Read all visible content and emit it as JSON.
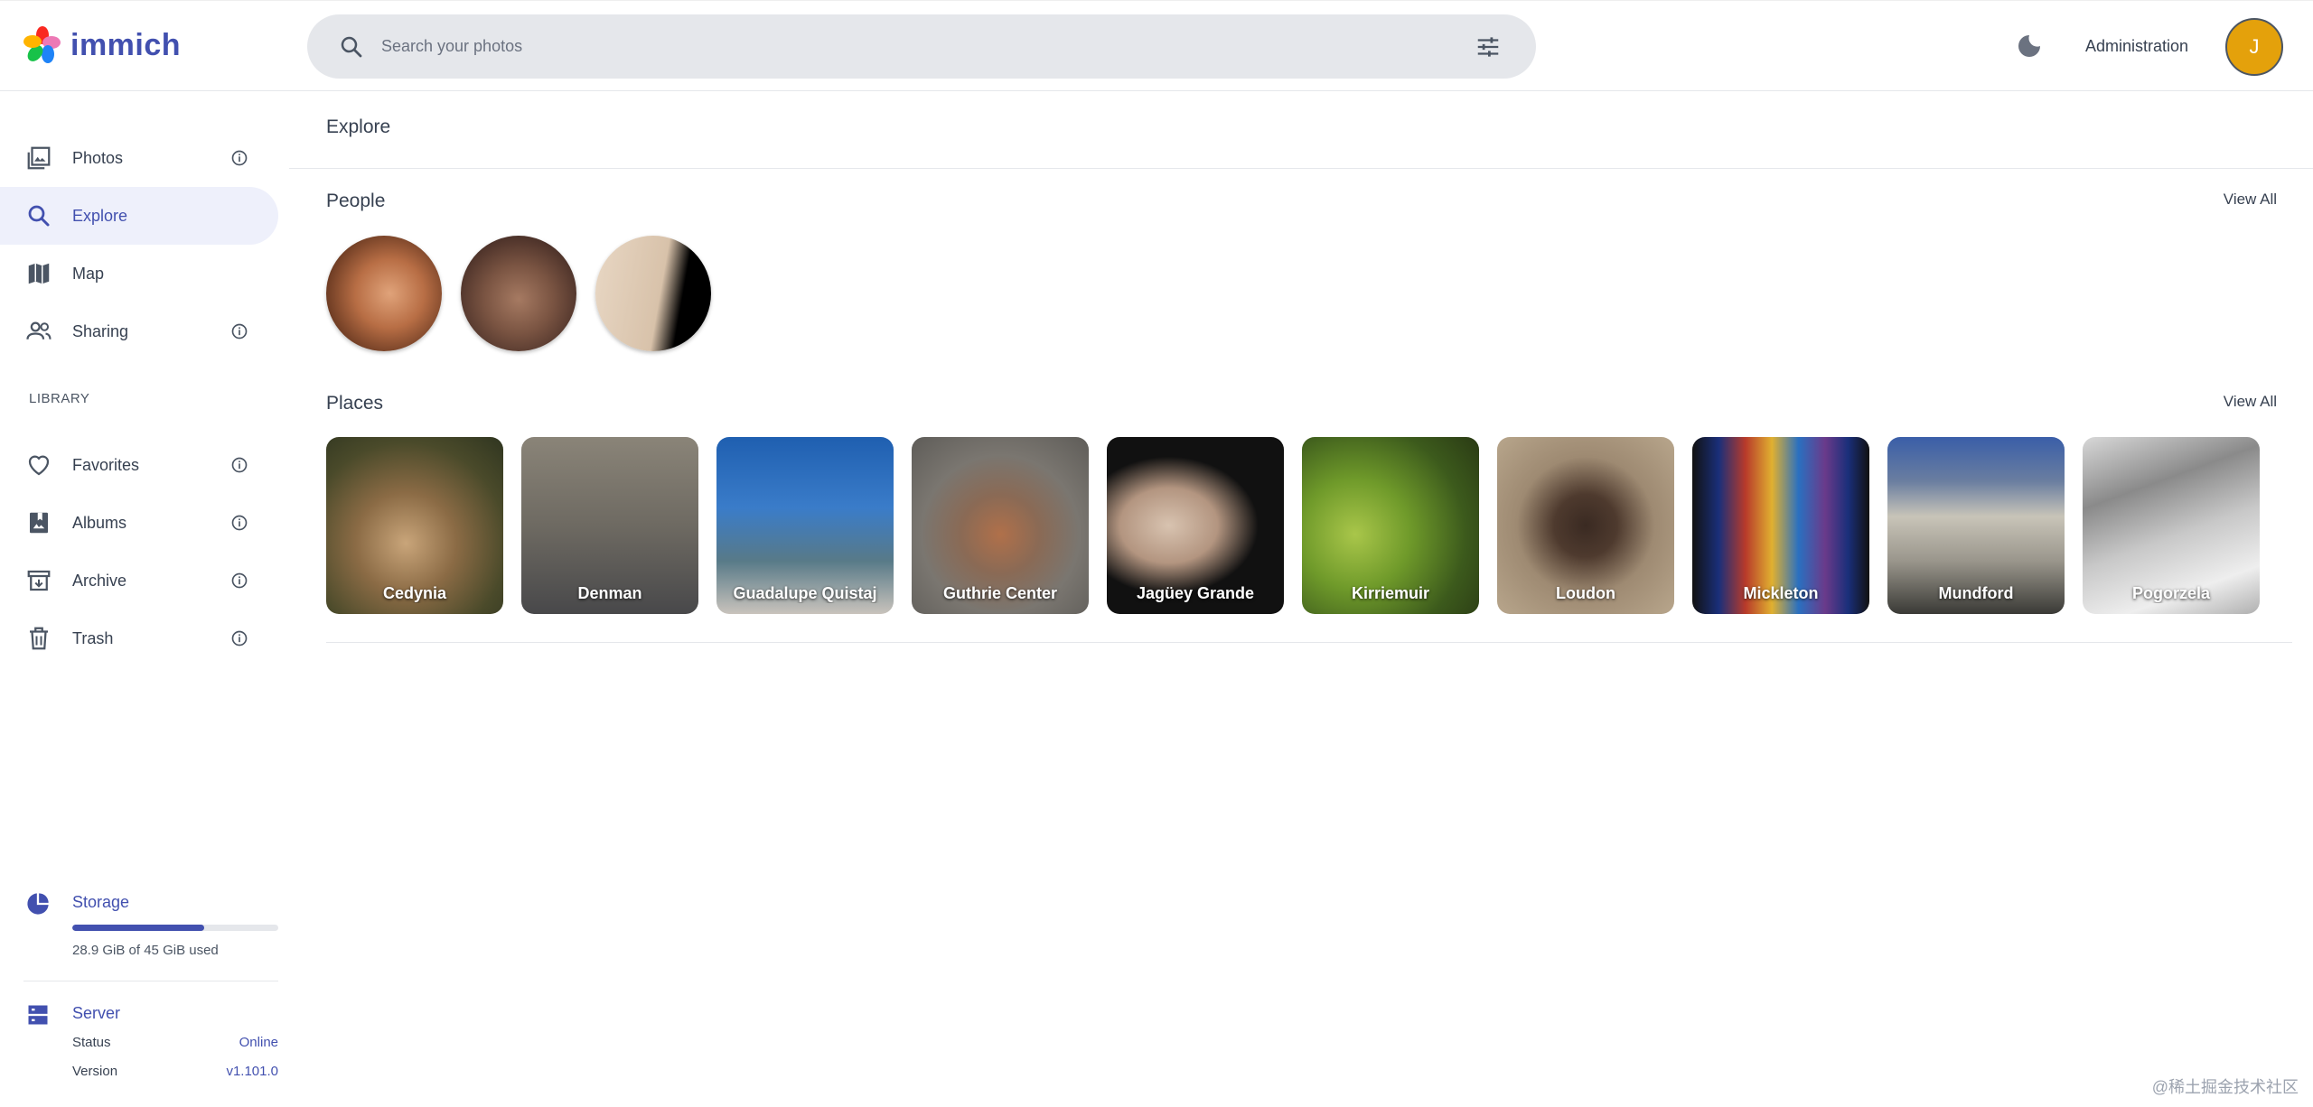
{
  "app": {
    "name": "immich"
  },
  "search": {
    "placeholder": "Search your photos"
  },
  "header": {
    "admin_label": "Administration",
    "avatar_initial": "J"
  },
  "sidebar": {
    "items": [
      {
        "label": "Photos",
        "icon": "photos-icon"
      },
      {
        "label": "Explore",
        "icon": "magnify-icon",
        "active": true
      },
      {
        "label": "Map",
        "icon": "map-icon"
      },
      {
        "label": "Sharing",
        "icon": "account-multiple-icon"
      }
    ],
    "library_label": "LIBRARY",
    "library_items": [
      {
        "label": "Favorites",
        "icon": "heart-icon"
      },
      {
        "label": "Albums",
        "icon": "album-icon"
      },
      {
        "label": "Archive",
        "icon": "archive-icon"
      },
      {
        "label": "Trash",
        "icon": "trash-icon"
      }
    ],
    "storage": {
      "title": "Storage",
      "used_fraction": 0.64,
      "text": "28.9 GiB of 45 GiB used"
    },
    "server": {
      "title": "Server",
      "status_key": "Status",
      "status_value": "Online",
      "version_key": "Version",
      "version_value": "v1.101.0"
    }
  },
  "main": {
    "title": "Explore",
    "people": {
      "title": "People",
      "view_all": "View All"
    },
    "places": {
      "title": "Places",
      "view_all": "View All",
      "items": [
        "Cedynia",
        "Denman",
        "Guadalupe Quistaj",
        "Guthrie Center",
        "Jagüey Grande",
        "Kirriemuir",
        "Loudon",
        "Mickleton",
        "Mundford",
        "Pogorzela"
      ]
    }
  },
  "watermark": "@稀土掘金技术社区",
  "colors": {
    "accent": "#4250af",
    "active_bg": "#eef0fb",
    "avatar": "#e4a10b"
  }
}
